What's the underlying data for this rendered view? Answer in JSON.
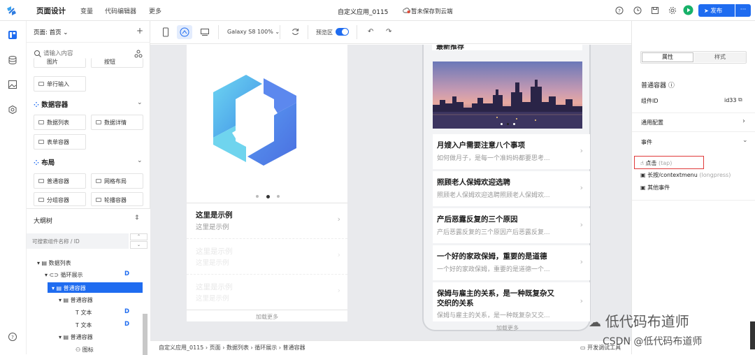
{
  "header": {
    "page_design": "页面设计",
    "nav": [
      "变量",
      "代码编辑器",
      "更多"
    ],
    "app_title": "自定义应用_0115",
    "save_status_prefix": "",
    "save_status": "暂未保存到云端",
    "publish_label": "发布",
    "more_label": "···",
    "colors": {
      "accent": "#1f6cf0",
      "run": "#17b169",
      "warn": "#e14a36"
    }
  },
  "rail": {
    "icons": [
      "pages-icon",
      "database-icon",
      "image-icon",
      "settings-icon",
      "help-icon"
    ]
  },
  "left_panel": {
    "page_selector": "页面: 首页",
    "add": "+",
    "search_placeholder": "请输入内容",
    "top_items": [
      "图片",
      "按钮"
    ],
    "single_input": "单行输入",
    "data_container_title": "数据容器",
    "data_items": [
      "数据列表",
      "数据详情",
      "表单容器"
    ],
    "layout_title": "布局",
    "layout_items": [
      "普通容器",
      "网格布局",
      "分组容器",
      "轮播容器"
    ],
    "outline_title": "大纲树",
    "outline_search_placeholder": "可搜索组件名称 / ID",
    "tree": [
      {
        "label": "数据列表",
        "badge": ""
      },
      {
        "label": "循环展示",
        "badge": "D"
      },
      {
        "label": "普通容器",
        "badge": "",
        "selected": true
      },
      {
        "label": "普通容器",
        "badge": ""
      },
      {
        "label": "文本",
        "badge": "D"
      },
      {
        "label": "文本",
        "badge": "D"
      },
      {
        "label": "普通容器",
        "badge": ""
      },
      {
        "label": "图标",
        "badge": ""
      }
    ]
  },
  "toolbar": {
    "device": "Galaxy S8 100%",
    "preview_label": "预览区",
    "preview_on": true
  },
  "phone1": {
    "carousel_dots": 3,
    "active_dot": 2,
    "rows": [
      {
        "title": "这里是示例",
        "sub": "这里是示例"
      },
      {
        "title": "这里是示例",
        "sub": "这里是示例"
      },
      {
        "title": "这里是示例",
        "sub": "这里是示例"
      }
    ],
    "load_more": "加载更多"
  },
  "phone2": {
    "section_title": "最新推荐",
    "banner_dots": 3,
    "news": [
      {
        "title": "月嫂入户需要注意八个事项",
        "sub": "如何做月子，是每一个准妈妈都要思考..."
      },
      {
        "title": "照顾老人保姆欢迎选聘",
        "sub": "照顾老人保姆欢迎选聘照顾老人保姆欢..."
      },
      {
        "title": "产后恶露反复的三个原因",
        "sub": "产后恶露反复的三个原因产后恶露反复..."
      },
      {
        "title": "一个好的家政保姆，重要的是道德",
        "sub": "一个好的家政保姆，重要的是道德一个..."
      },
      {
        "title": "保姆与雇主的关系，是一种既复杂又",
        "title2": "交织的关系",
        "sub": "保姆与雇主的关系，是一种既复杂又交..."
      }
    ],
    "load_more": "加载更多"
  },
  "breadcrumb": [
    "自定义应用_0115",
    "页面",
    "数据列表",
    "循环展示",
    "普通容器"
  ],
  "debug_label": "开发调试工具",
  "right_panel": {
    "tabs": [
      "属性",
      "样式"
    ],
    "active_tab": 0,
    "component_title": "普通容器",
    "id_label": "组件ID",
    "id_value": "id33",
    "general_config": "通用配置",
    "events_title": "事件",
    "events": [
      {
        "label": "点击",
        "hint": "(tap)"
      },
      {
        "label": "长按/contextmenu",
        "hint": "(longpress)"
      },
      {
        "label": "其他事件",
        "hint": ""
      }
    ]
  },
  "watermark": {
    "line1": "低代码布道师",
    "line2": "CSDN @低代码布道师"
  }
}
